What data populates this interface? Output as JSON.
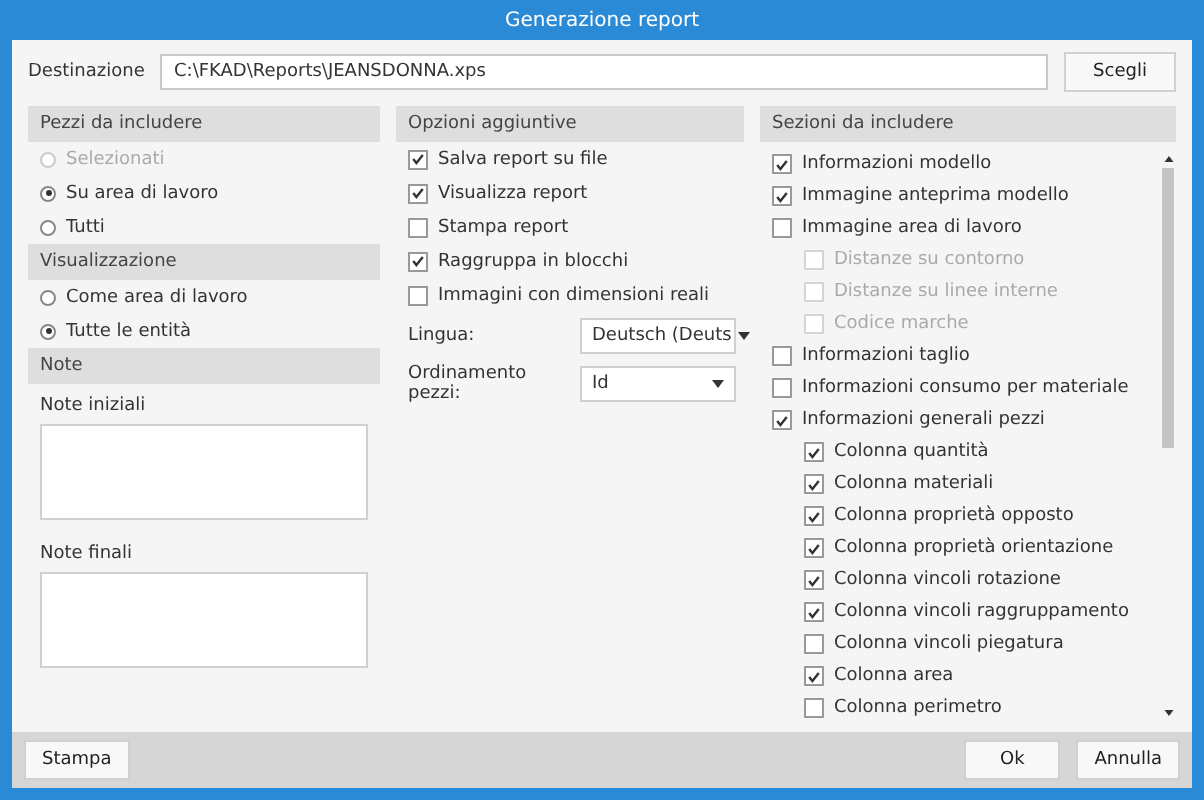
{
  "window": {
    "title": "Generazione report"
  },
  "destination": {
    "label": "Destinazione",
    "value": "C:\\FKAD\\Reports\\JEANSDONNA.xps",
    "button": "Scegli"
  },
  "pieces": {
    "title": "Pezzi da includere",
    "options": [
      {
        "label": "Selezionati",
        "selected": false,
        "disabled": true
      },
      {
        "label": "Su area di lavoro",
        "selected": true,
        "disabled": false
      },
      {
        "label": "Tutti",
        "selected": false,
        "disabled": false
      }
    ]
  },
  "view": {
    "title": "Visualizzazione",
    "options": [
      {
        "label": "Come area di lavoro",
        "selected": false,
        "disabled": false
      },
      {
        "label": "Tutte le entità",
        "selected": true,
        "disabled": false
      }
    ]
  },
  "notes": {
    "title": "Note",
    "fields": [
      {
        "label": "Note iniziali"
      },
      {
        "label": "Note finali"
      }
    ]
  },
  "options": {
    "title": "Opzioni aggiuntive",
    "checks": [
      {
        "label": "Salva report su file",
        "checked": true
      },
      {
        "label": "Visualizza report",
        "checked": true
      },
      {
        "label": "Stampa report",
        "checked": false
      },
      {
        "label": "Raggruppa in blocchi",
        "checked": true
      },
      {
        "label": "Immagini con dimensioni reali",
        "checked": false
      }
    ],
    "selects": [
      {
        "label": "Lingua:",
        "value": "Deutsch (Deuts"
      },
      {
        "label": "Ordinamento pezzi:",
        "value": "Id"
      }
    ]
  },
  "sections": {
    "title": "Sezioni da includere",
    "items": [
      {
        "label": "Informazioni modello",
        "checked": true,
        "disabled": false
      },
      {
        "label": "Immagine anteprima modello",
        "checked": true,
        "disabled": false
      },
      {
        "label": "Immagine area di lavoro",
        "checked": false,
        "disabled": false,
        "children": [
          {
            "label": "Distanze su contorno",
            "checked": false,
            "disabled": true
          },
          {
            "label": "Distanze su linee interne",
            "checked": false,
            "disabled": true
          },
          {
            "label": "Codice marche",
            "checked": false,
            "disabled": true
          }
        ]
      },
      {
        "label": "Informazioni taglio",
        "checked": false,
        "disabled": false
      },
      {
        "label": "Informazioni consumo per materiale",
        "checked": false,
        "disabled": false
      },
      {
        "label": "Informazioni generali pezzi",
        "checked": true,
        "disabled": false,
        "children": [
          {
            "label": "Colonna quantità",
            "checked": true,
            "disabled": false
          },
          {
            "label": "Colonna materiali",
            "checked": true,
            "disabled": false
          },
          {
            "label": "Colonna proprietà opposto",
            "checked": true,
            "disabled": false
          },
          {
            "label": "Colonna proprietà orientazione",
            "checked": true,
            "disabled": false
          },
          {
            "label": "Colonna vincoli rotazione",
            "checked": true,
            "disabled": false
          },
          {
            "label": "Colonna vincoli raggruppamento",
            "checked": true,
            "disabled": false
          },
          {
            "label": "Colonna vincoli piegatura",
            "checked": false,
            "disabled": false
          },
          {
            "label": "Colonna area",
            "checked": true,
            "disabled": false
          },
          {
            "label": "Colonna perimetro",
            "checked": false,
            "disabled": false
          }
        ]
      }
    ]
  },
  "buttons": {
    "left": [
      "Stampa"
    ],
    "right": [
      "Ok",
      "Annulla"
    ]
  }
}
